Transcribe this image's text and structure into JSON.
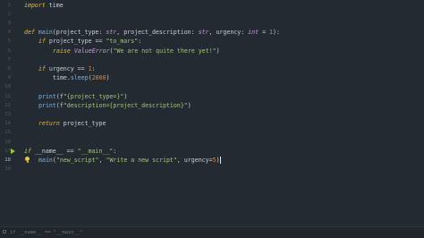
{
  "editor": {
    "colors": {
      "background": "#232a31",
      "keyword": "#d9b84d",
      "function": "#82b2dc",
      "string": "#a2c86e",
      "number": "#d08a56",
      "type": "#c89bd6",
      "text": "#c9d1d9",
      "line_number": "#4f5962",
      "gutter_run": "#9bc93b"
    },
    "line_numbers": [
      "1",
      "2",
      "3",
      "4",
      "5",
      "6",
      "7",
      "8",
      "9",
      "10",
      "11",
      "12",
      "13",
      "14",
      "15",
      "16",
      "17",
      "18",
      "19"
    ],
    "current_line": "18",
    "lines": [
      {
        "ln": "1",
        "indent": 0,
        "tokens": [
          {
            "t": "import",
            "c": "kw"
          },
          {
            "t": " time",
            "c": "txt"
          }
        ]
      },
      {
        "ln": "2",
        "indent": 0,
        "tokens": []
      },
      {
        "ln": "3",
        "indent": 0,
        "tokens": []
      },
      {
        "ln": "4",
        "indent": 0,
        "tokens": [
          {
            "t": "def",
            "c": "kw"
          },
          {
            "t": " ",
            "c": "txt"
          },
          {
            "t": "main",
            "c": "fn"
          },
          {
            "t": "(project_type: ",
            "c": "txt"
          },
          {
            "t": "str",
            "c": "ty"
          },
          {
            "t": ", project_description: ",
            "c": "txt"
          },
          {
            "t": "str",
            "c": "ty"
          },
          {
            "t": ", urgency: ",
            "c": "txt"
          },
          {
            "t": "int",
            "c": "ty"
          },
          {
            "t": " = ",
            "c": "txt"
          },
          {
            "t": "1",
            "c": "num"
          },
          {
            "t": "):",
            "c": "txt"
          }
        ]
      },
      {
        "ln": "5",
        "indent": 1,
        "tokens": [
          {
            "t": "if",
            "c": "kw"
          },
          {
            "t": " project_type == ",
            "c": "txt"
          },
          {
            "t": "\"to_mars\"",
            "c": "str"
          },
          {
            "t": ":",
            "c": "txt"
          }
        ]
      },
      {
        "ln": "6",
        "indent": 2,
        "tokens": [
          {
            "t": "raise",
            "c": "kw"
          },
          {
            "t": " ",
            "c": "txt"
          },
          {
            "t": "ValueError",
            "c": "ty"
          },
          {
            "t": "(",
            "c": "txt"
          },
          {
            "t": "\"We are not quite there yet!\"",
            "c": "str"
          },
          {
            "t": ")",
            "c": "txt"
          }
        ]
      },
      {
        "ln": "7",
        "indent": 0,
        "tokens": []
      },
      {
        "ln": "8",
        "indent": 1,
        "tokens": [
          {
            "t": "if",
            "c": "kw"
          },
          {
            "t": " urgency == ",
            "c": "txt"
          },
          {
            "t": "1",
            "c": "num"
          },
          {
            "t": ":",
            "c": "txt"
          }
        ]
      },
      {
        "ln": "9",
        "indent": 2,
        "tokens": [
          {
            "t": "time.",
            "c": "txt"
          },
          {
            "t": "sleep",
            "c": "fn"
          },
          {
            "t": "(",
            "c": "txt"
          },
          {
            "t": "2000",
            "c": "num"
          },
          {
            "t": ")",
            "c": "txt"
          }
        ]
      },
      {
        "ln": "10",
        "indent": 0,
        "tokens": []
      },
      {
        "ln": "11",
        "indent": 1,
        "tokens": [
          {
            "t": "print",
            "c": "fn"
          },
          {
            "t": "(f",
            "c": "txt"
          },
          {
            "t": "\"{project_type=}\"",
            "c": "str"
          },
          {
            "t": ")",
            "c": "txt"
          }
        ]
      },
      {
        "ln": "12",
        "indent": 1,
        "tokens": [
          {
            "t": "print",
            "c": "fn"
          },
          {
            "t": "(f",
            "c": "txt"
          },
          {
            "t": "\"description={project_description}\"",
            "c": "str"
          },
          {
            "t": ")",
            "c": "txt"
          }
        ]
      },
      {
        "ln": "13",
        "indent": 0,
        "tokens": []
      },
      {
        "ln": "14",
        "indent": 1,
        "tokens": [
          {
            "t": "return",
            "c": "kw"
          },
          {
            "t": " project_type",
            "c": "txt"
          }
        ]
      },
      {
        "ln": "15",
        "indent": 0,
        "tokens": []
      },
      {
        "ln": "16",
        "indent": 0,
        "tokens": []
      },
      {
        "ln": "17",
        "indent": 0,
        "tokens": [
          {
            "t": "if",
            "c": "kw"
          },
          {
            "t": " __name__ == ",
            "c": "txt"
          },
          {
            "t": "\"__main__\"",
            "c": "str"
          },
          {
            "t": ":",
            "c": "txt"
          }
        ]
      },
      {
        "ln": "18",
        "indent": 1,
        "tokens": [
          {
            "t": "main",
            "c": "fn"
          },
          {
            "t": "(",
            "c": "txt"
          },
          {
            "t": "\"new_script\"",
            "c": "str"
          },
          {
            "t": ", ",
            "c": "txt"
          },
          {
            "t": "\"Write a new script\"",
            "c": "str"
          },
          {
            "t": ", urgency=",
            "c": "txt"
          },
          {
            "t": "5",
            "c": "num"
          },
          {
            "t": ")",
            "c": "txt"
          }
        ]
      },
      {
        "ln": "19",
        "indent": 0,
        "tokens": []
      }
    ],
    "run_marker_line": "17",
    "bulb_line": "18"
  },
  "breadcrumb": {
    "icon": "function-icon",
    "text": "if __name__ == \"__main__\""
  }
}
